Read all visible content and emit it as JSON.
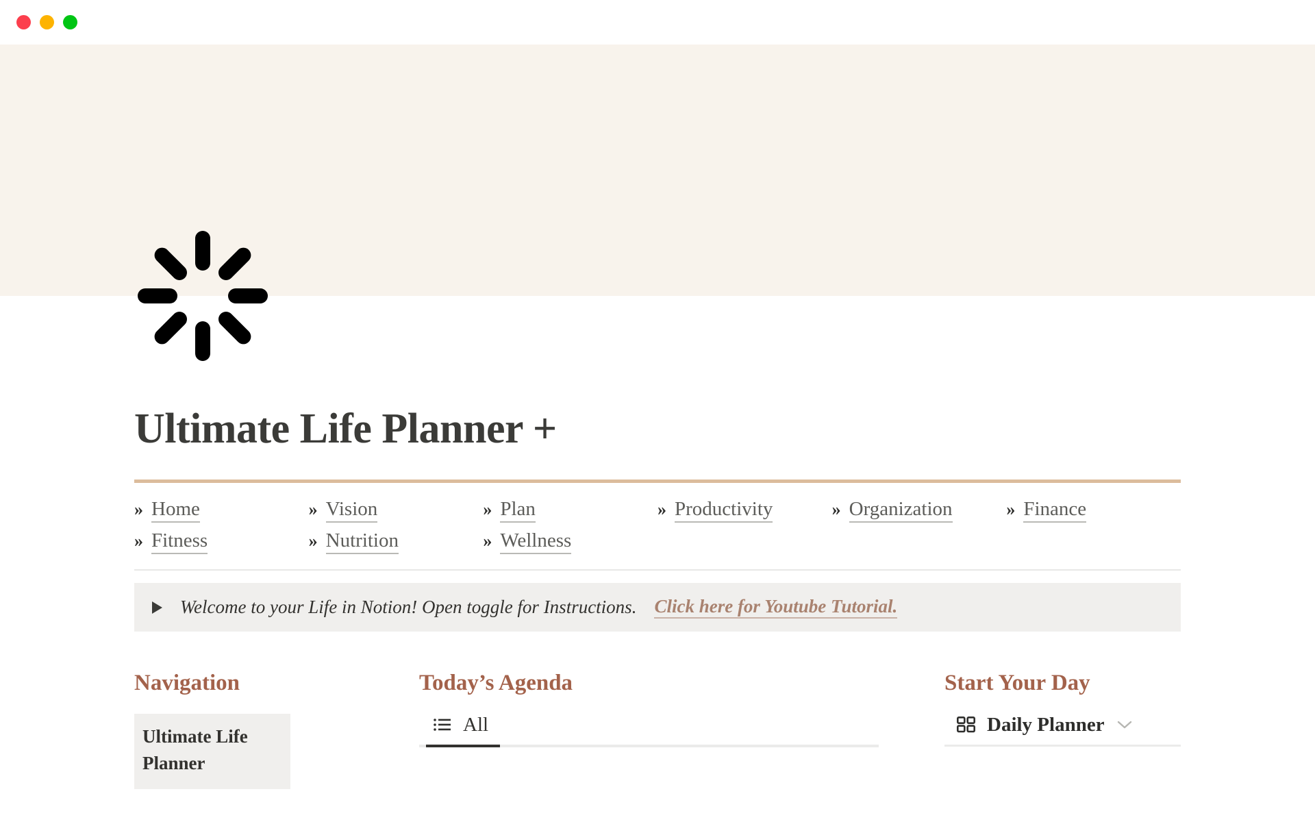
{
  "window": {
    "traffic_lights": [
      {
        "name": "close",
        "color": "#fc3f4d"
      },
      {
        "name": "minimize",
        "color": "#fdb300"
      },
      {
        "name": "maximize",
        "color": "#00c514"
      }
    ]
  },
  "cover": {
    "background_color": "#f8f3ec",
    "page_icon": "loading-spinner-icon"
  },
  "page": {
    "title": "Ultimate Life Planner +",
    "divider_color": "#dcbc9c"
  },
  "nav_links": [
    {
      "label": "Home"
    },
    {
      "label": "Vision"
    },
    {
      "label": "Plan"
    },
    {
      "label": "Productivity"
    },
    {
      "label": "Organization"
    },
    {
      "label": "Finance"
    },
    {
      "label": "Fitness"
    },
    {
      "label": "Nutrition"
    },
    {
      "label": "Wellness"
    }
  ],
  "callout": {
    "toggle_icon": "caret-right-icon",
    "text": "Welcome to your Life in Notion! Open toggle for Instructions.",
    "link_text": "Click here for Youtube Tutorial.",
    "link_color": "#a9826f",
    "background_color": "#f0efed"
  },
  "columns": {
    "navigation": {
      "heading": "Navigation",
      "items": [
        {
          "label": "Ultimate Life Planner"
        }
      ]
    },
    "agenda": {
      "heading": "Today’s Agenda",
      "tabs": [
        {
          "label": "All",
          "icon": "list-view-icon",
          "active": true
        }
      ]
    },
    "start_your_day": {
      "heading": "Start Your Day",
      "view": {
        "label": "Daily Planner",
        "icon": "gallery-view-icon",
        "chevron_icon": "chevron-down-icon"
      }
    }
  },
  "accent_colors": {
    "heading": "#a3624b",
    "link": "#a9826f",
    "rule": "#dcbc9c"
  }
}
